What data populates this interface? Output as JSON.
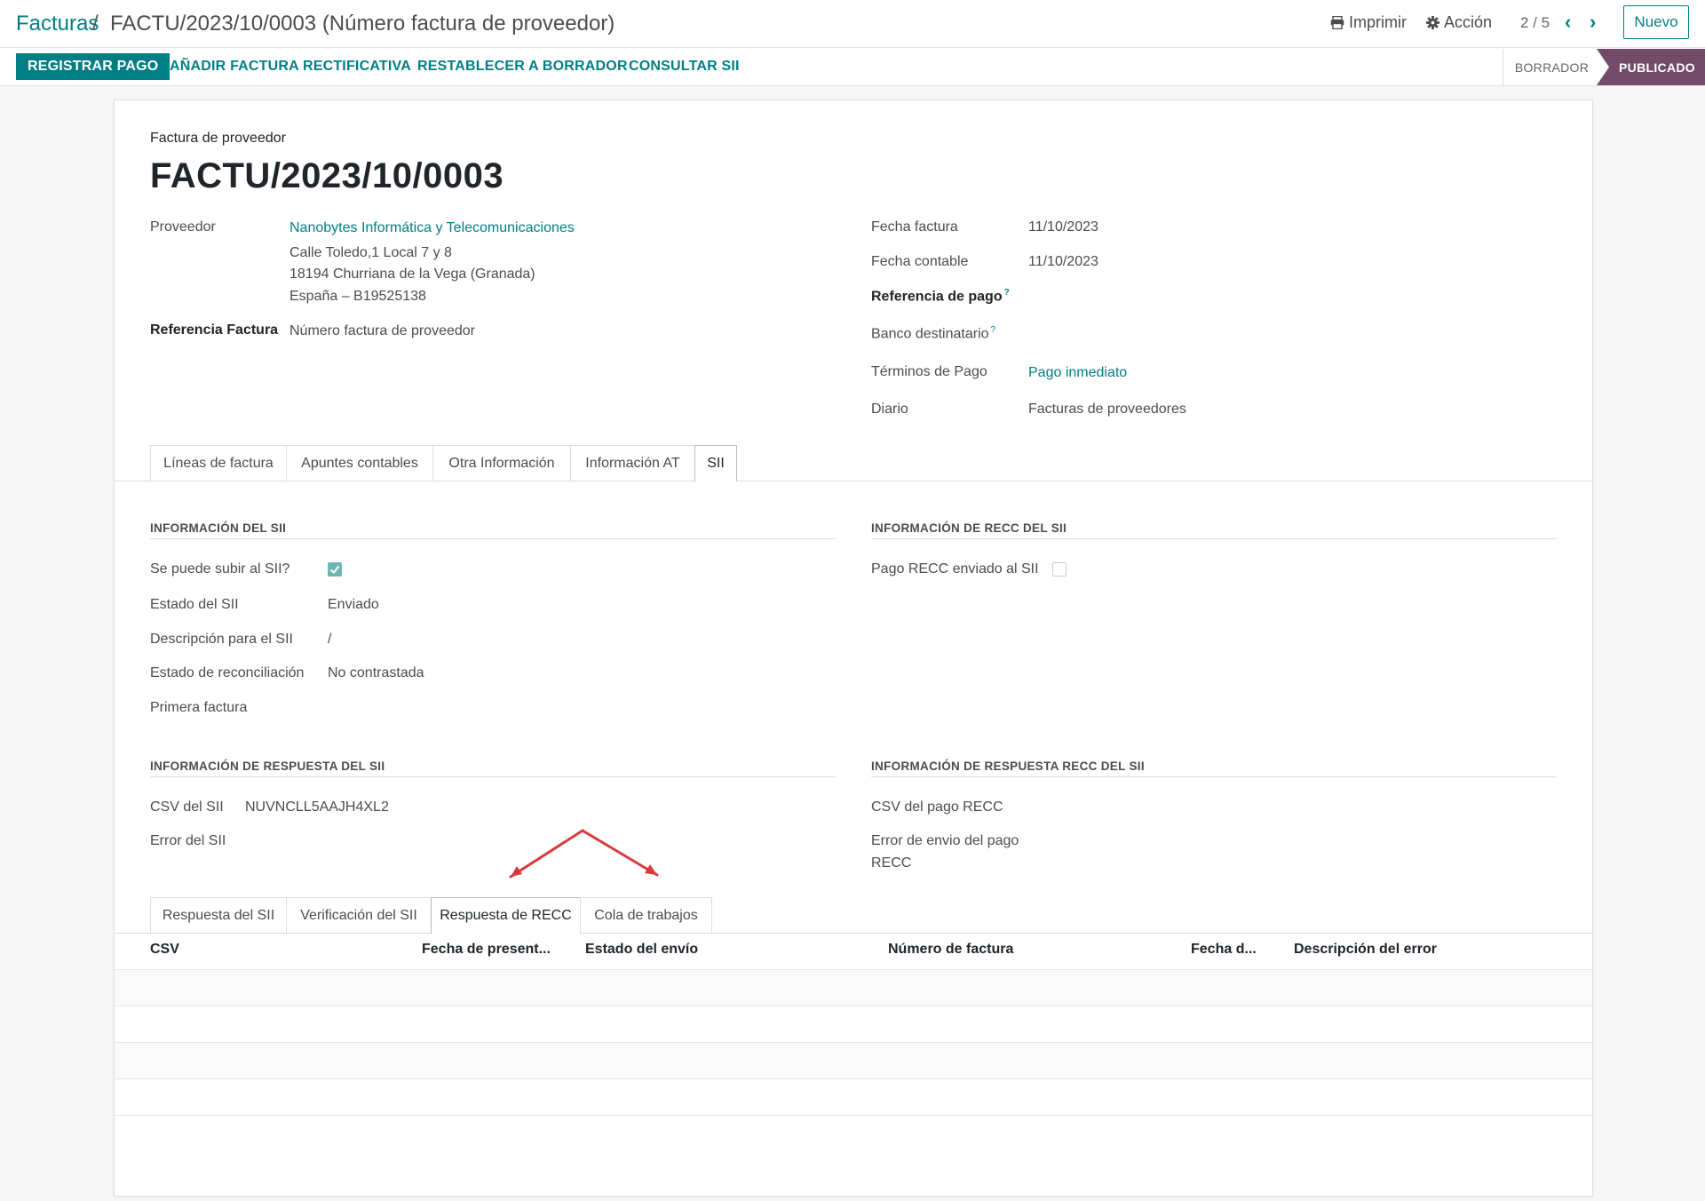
{
  "breadcrumb": {
    "parent": "Facturas",
    "separator": "/",
    "current": "FACTU/2023/10/0003 (Número factura de proveedor)"
  },
  "top_actions": {
    "print_label": "Imprimir",
    "action_label": "Acción",
    "pager_text": "2 / 5",
    "new_label": "Nuevo"
  },
  "status_bar": {
    "buttons": [
      "REGISTRAR PAGO",
      "AÑADIR FACTURA RECTIFICATIVA",
      "RESTABLECER A BORRADOR",
      "CONSULTAR SII"
    ],
    "stages": [
      "BORRADOR",
      "PUBLICADO"
    ],
    "active_stage": "PUBLICADO"
  },
  "invoice": {
    "type_label": "Factura de proveedor",
    "name": "FACTU/2023/10/0003",
    "vendor_label": "Proveedor",
    "vendor_name": "Nanobytes Informática y Telecomunicaciones",
    "vendor_address": [
      "Calle Toledo,1 Local 7 y 8",
      "18194 Churriana de la Vega (Granada)",
      "España – B19525138"
    ],
    "ref_label": "Referencia Factura",
    "ref_value": "Número factura de proveedor",
    "invoice_date_label": "Fecha factura",
    "invoice_date": "11/10/2023",
    "accounting_date_label": "Fecha contable",
    "accounting_date": "11/10/2023",
    "payment_ref_label": "Referencia de pago",
    "bank_label": "Banco destinatario",
    "help_mark": "?",
    "terms_label": "Términos de Pago",
    "terms_value": "Pago inmediato",
    "journal_label": "Diario",
    "journal_value": "Facturas de proveedores"
  },
  "main_tabs": [
    "Líneas de factura",
    "Apuntes contables",
    "Otra Información",
    "Información AT",
    "SII"
  ],
  "active_main_tab": "SII",
  "sii": {
    "info_title": "INFORMACIÓN DEL SII",
    "can_upload_label": "Se puede subir al SII?",
    "can_upload": true,
    "state_label": "Estado del SII",
    "state_value": "Enviado",
    "description_label": "Descripción para el SII",
    "description_value": "/",
    "reconcile_label": "Estado de reconciliación",
    "reconcile_value": "No contrastada",
    "first_invoice_label": "Primera factura",
    "recc_title": "INFORMACIÓN DE RECC DEL SII",
    "recc_sent_label": "Pago RECC enviado al SII",
    "recc_sent": false,
    "response_title": "INFORMACIÓN DE RESPUESTA DEL SII",
    "csv_label": "CSV del SII",
    "csv_value": "NUVNCLL5AAJH4XL2",
    "error_label": "Error del SII",
    "recc_response_title": "INFORMACIÓN DE RESPUESTA RECC DEL SII",
    "recc_csv_label": "CSV del pago RECC",
    "recc_error_label_1": "Error de envio del pago",
    "recc_error_label_2": "RECC"
  },
  "sub_tabs": [
    "Respuesta del SII",
    "Verificación del SII",
    "Respuesta de RECC",
    "Cola de trabajos"
  ],
  "active_sub_tab": "Respuesta de RECC",
  "table": {
    "columns": [
      "CSV",
      "Fecha de present...",
      "Estado del envío",
      "Número de factura",
      "Fecha d...",
      "Descripción del error"
    ],
    "rows": []
  },
  "colors": {
    "primary": "#017e84",
    "active_stage": "#714b67",
    "annotation_arrow": "#d9393e"
  }
}
